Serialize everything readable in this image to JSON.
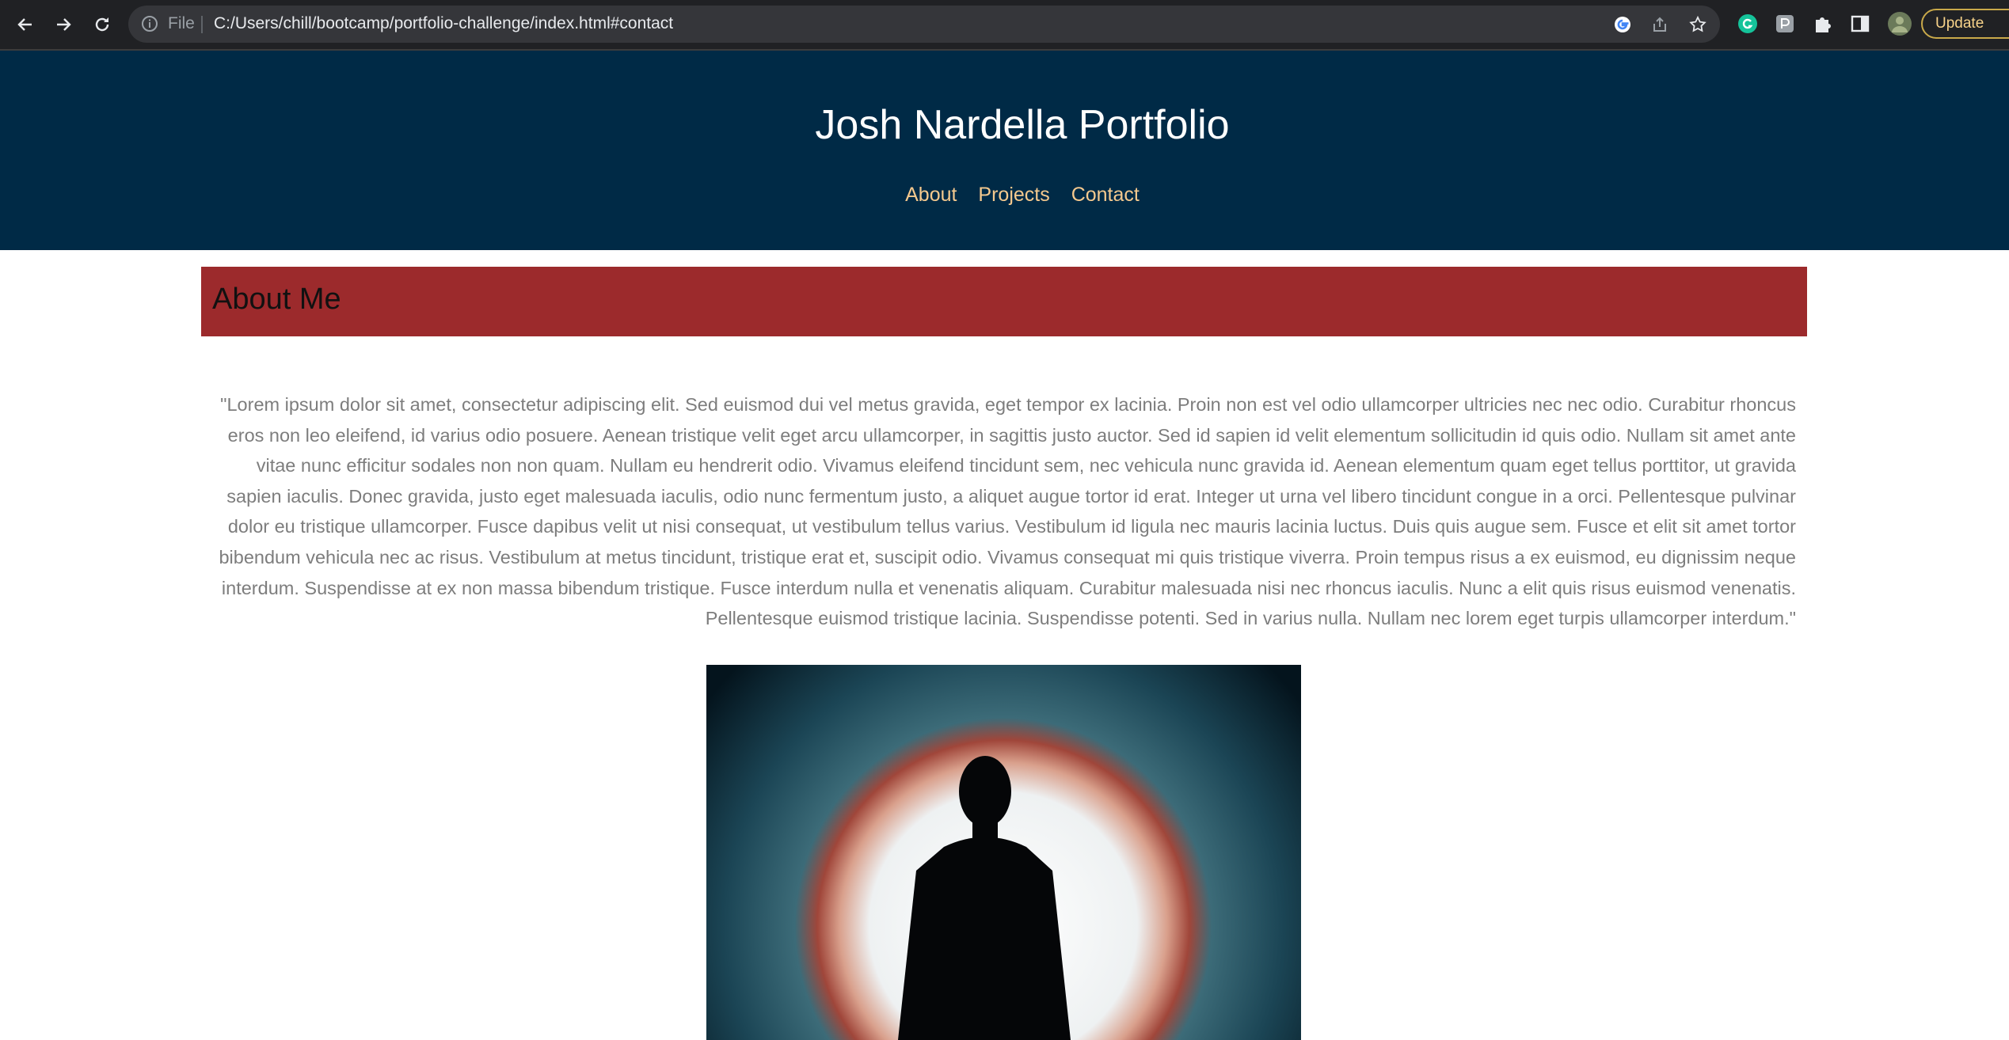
{
  "browser": {
    "omnibox_prefix": "File",
    "url": "C:/Users/chill/bootcamp/portfolio-challenge/index.html#contact",
    "update_label": "Update"
  },
  "header": {
    "title": "Josh Nardella Portfolio",
    "nav": [
      "About",
      "Projects",
      "Contact"
    ]
  },
  "about": {
    "heading": "About Me",
    "text": "\"Lorem ipsum dolor sit amet, consectetur adipiscing elit. Sed euismod dui vel metus gravida, eget tempor ex lacinia. Proin non est vel odio ullamcorper ultricies nec nec odio. Curabitur rhoncus eros non leo eleifend, id varius odio posuere. Aenean tristique velit eget arcu ullamcorper, in sagittis justo auctor. Sed id sapien id velit elementum sollicitudin id quis odio. Nullam sit amet ante vitae nunc efficitur sodales non non quam. Nullam eu hendrerit odio. Vivamus eleifend tincidunt sem, nec vehicula nunc gravida id. Aenean elementum quam eget tellus porttitor, ut gravida sapien iaculis. Donec gravida, justo eget malesuada iaculis, odio nunc fermentum justo, a aliquet augue tortor id erat. Integer ut urna vel libero tincidunt congue in a orci. Pellentesque pulvinar dolor eu tristique ullamcorper. Fusce dapibus velit ut nisi consequat, ut vestibulum tellus varius. Vestibulum id ligula nec mauris lacinia luctus. Duis quis augue sem. Fusce et elit sit amet tortor bibendum vehicula nec ac risus. Vestibulum at metus tincidunt, tristique erat et, suscipit odio. Vivamus consequat mi quis tristique viverra. Proin tempus risus a ex euismod, eu dignissim neque interdum. Suspendisse at ex non massa bibendum tristique. Fusce interdum nulla et venenatis aliquam. Curabitur malesuada nisi nec rhoncus iaculis. Nunc a elit quis risus euismod venenatis. Pellentesque euismod tristique lacinia. Suspendisse potenti. Sed in varius nulla. Nullam nec lorem eget turpis ullamcorper interdum.\""
  },
  "colors": {
    "header_bg": "#002a46",
    "nav_link": "#f5c98e",
    "about_bar": "#9c2a2c",
    "body_text": "#7d7d7d"
  }
}
